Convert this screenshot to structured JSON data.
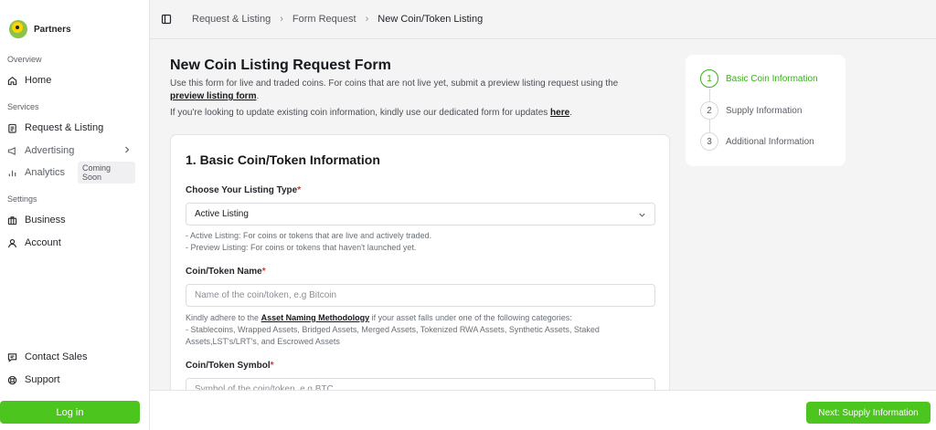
{
  "brand": {
    "name": "Partners"
  },
  "sidebar": {
    "sections": [
      "Overview",
      "Services",
      "Settings"
    ],
    "items": [
      {
        "label": "Home",
        "icon": "home-icon"
      },
      {
        "label": "Request & Listing",
        "icon": "clipboard-icon"
      },
      {
        "label": "Advertising",
        "icon": "megaphone-icon"
      },
      {
        "label": "Analytics",
        "icon": "bar-chart-icon",
        "badge": "Coming Soon"
      },
      {
        "label": "Business",
        "icon": "briefcase-icon"
      },
      {
        "label": "Account",
        "icon": "user-icon"
      },
      {
        "label": "Contact Sales",
        "icon": "chat-icon"
      },
      {
        "label": "Support",
        "icon": "lifebuoy-icon"
      }
    ],
    "login_label": "Log in"
  },
  "breadcrumb": [
    "Request & Listing",
    "Form Request",
    "New Coin/Token Listing"
  ],
  "page": {
    "title": "New Coin Listing Request Form",
    "intro_text": "Use this form for live and traded coins. For coins that are not live yet, submit a preview listing request using the",
    "intro_link": "preview listing form",
    "intro_end": ".",
    "update_text": "If you're looking to update existing coin information, kindly use our dedicated form for updates",
    "update_link": "here",
    "update_end": "."
  },
  "form": {
    "section_title": "1. Basic Coin/Token Information",
    "listing_type": {
      "label": "Choose Your Listing Type",
      "required": "*",
      "value": "Active Listing",
      "help": [
        "- Active Listing: For coins or tokens that are live and actively traded.",
        "- Preview Listing: For coins or tokens that haven't launched yet."
      ]
    },
    "name": {
      "label": "Coin/Token Name",
      "required": "*",
      "placeholder": "Name of the coin/token, e.g Bitcoin",
      "help_prefix": "Kindly adhere to the",
      "help_link": "Asset Naming Methodology",
      "help_suffix": "if your asset falls under one of the following categories:",
      "help_line2": "- Stablecoins, Wrapped Assets, Bridged Assets, Merged Assets, Tokenized RWA Assets, Synthetic Assets, Staked",
      "help_line3": "Assets,LST's/LRT's, and Escrowed Assets"
    },
    "symbol": {
      "label": "Coin/Token Symbol",
      "required": "*",
      "placeholder": "Symbol of the coin/token, e.g BTC"
    }
  },
  "stepper": {
    "steps": [
      {
        "num": "1",
        "label": "Basic Coin Information"
      },
      {
        "num": "2",
        "label": "Supply Information"
      },
      {
        "num": "3",
        "label": "Additional Information"
      }
    ]
  },
  "footer": {
    "next_label": "Next: Supply Information"
  },
  "colors": {
    "accent": "#4cc51f",
    "active_step": "#39b01b",
    "required": "#e0322f"
  }
}
